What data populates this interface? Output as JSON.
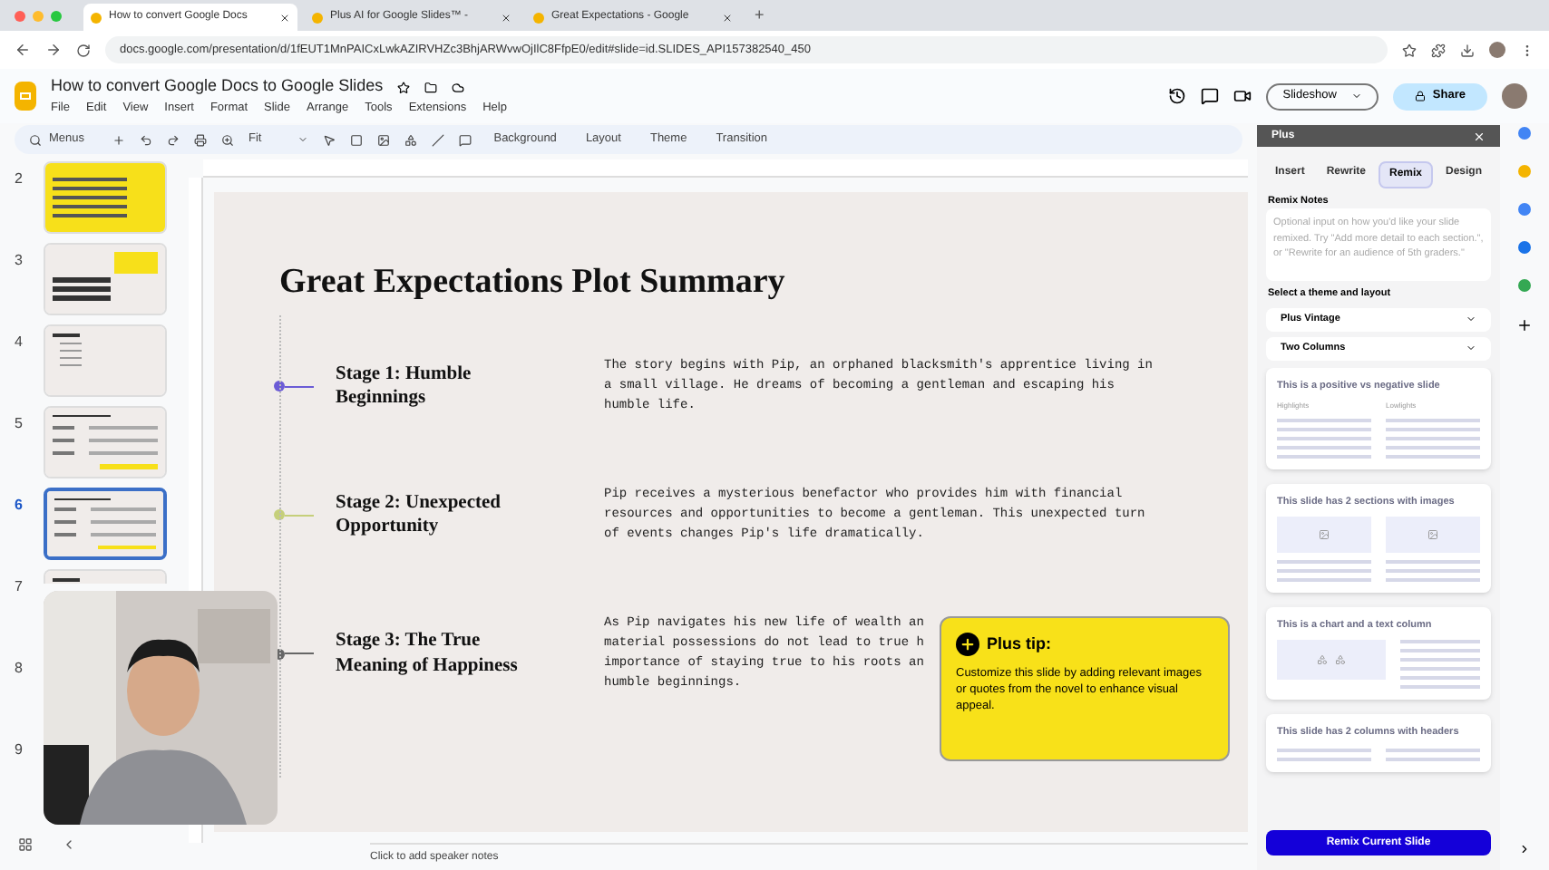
{
  "browser": {
    "tabs": [
      {
        "title": "How to convert Google Docs",
        "selected": true
      },
      {
        "title": "Plus AI for Google Slides™ -",
        "selected": false
      },
      {
        "title": "Great Expectations - Google",
        "selected": false
      }
    ],
    "new_tab": "+",
    "url": "docs.google.com/presentation/d/1fEUT1MnPAICxLwkAZIRVHZc3BhjARWvwOjIlC8FfpE0/edit#slide=id.SLIDES_API157382540_450"
  },
  "doc": {
    "title": "How to convert Google Docs to Google Slides",
    "menus": [
      "File",
      "Edit",
      "View",
      "Insert",
      "Format",
      "Slide",
      "Arrange",
      "Tools",
      "Extensions",
      "Help"
    ],
    "slideshow": "Slideshow",
    "share": "Share"
  },
  "toolbar": {
    "search": "Menus",
    "zoom": "Fit",
    "buttons": [
      "Background",
      "Layout",
      "Theme",
      "Transition"
    ]
  },
  "filmstrip": [
    {
      "number": "2",
      "kind": "yellow",
      "selected": false
    },
    {
      "number": "3",
      "kind": "title",
      "selected": false
    },
    {
      "number": "4",
      "kind": "agenda",
      "selected": false
    },
    {
      "number": "5",
      "kind": "rows",
      "selected": false
    },
    {
      "number": "6",
      "kind": "rows",
      "selected": true
    },
    {
      "number": "7",
      "kind": "partial",
      "selected": false
    },
    {
      "number": "8",
      "kind": "hidden",
      "selected": false
    },
    {
      "number": "9",
      "kind": "hidden",
      "selected": false
    }
  ],
  "slide": {
    "title": "Great Expectations Plot Summary",
    "stages": [
      {
        "title": "Stage 1: Humble Beginnings",
        "color": "#6b5bd6",
        "lines": [
          "The story begins with Pip, an orphaned blacksmith's apprentice living in",
          "a small village. He dreams of becoming a gentleman and escaping his",
          "humble life."
        ]
      },
      {
        "title": "Stage 2: Unexpected Opportunity",
        "color": "#c5cf7a",
        "lines": [
          "Pip receives a mysterious benefactor who provides him with financial",
          "resources and opportunities to become a gentleman. This unexpected turn",
          "of events changes Pip's life dramatically."
        ]
      },
      {
        "title": "Stage 3: The True Meaning of Happiness",
        "color": "#666666",
        "lines": [
          "As Pip navigates his new life of wealth an",
          "material possessions do not lead to true h",
          "importance of staying true to his roots an",
          "humble beginnings."
        ]
      }
    ],
    "tip": {
      "title": "Plus tip:",
      "text": "Customize this slide by adding relevant images or quotes from the novel to enhance visual appeal."
    }
  },
  "speaker_notes": {
    "placeholder": "Click to add speaker notes"
  },
  "panel": {
    "title": "Plus",
    "tabs": [
      {
        "label": "Insert",
        "selected": false
      },
      {
        "label": "Rewrite",
        "selected": false
      },
      {
        "label": "Remix",
        "selected": true
      },
      {
        "label": "Design",
        "selected": false
      }
    ],
    "notes_label": "Remix Notes",
    "notes_placeholder": "Optional input on how you'd like your slide remixed. Try \"Add more detail to each section.\", or \"Rewrite for an audience of 5th graders.\"",
    "theme_label": "Select a theme and layout",
    "selects": [
      "Plus Vintage",
      "Two Columns"
    ],
    "layouts": [
      {
        "kind": "lists",
        "title": "This is a positive vs negative slide",
        "labels": [
          "Highlights",
          "Lowlights"
        ]
      },
      {
        "kind": "images",
        "title": "This slide has 2 sections with images"
      },
      {
        "kind": "chart",
        "title": "This is a chart and a text column"
      },
      {
        "kind": "headers",
        "title": "This slide has 2 columns with headers"
      }
    ],
    "button": "Remix Current Slide"
  }
}
